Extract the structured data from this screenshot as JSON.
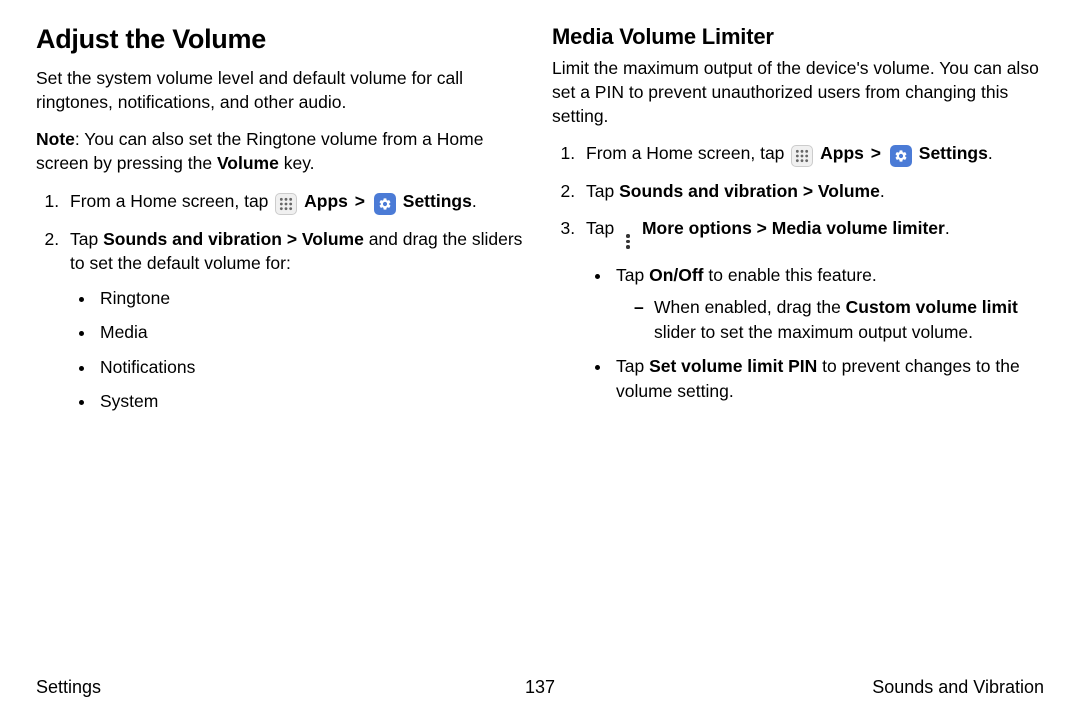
{
  "left": {
    "title": "Adjust the Volume",
    "intro": "Set the system volume level and default volume for call ringtones, notifications, and other audio.",
    "note_label": "Note",
    "note_pre": ": You can also set the Ringtone volume from a Home screen by pressing the ",
    "note_bold": "Volume",
    "note_post": " key.",
    "step1_pre": "From a Home screen, tap ",
    "apps_label": "Apps",
    "chev": ">",
    "settings_label": "Settings",
    "period": ".",
    "step2_pre": "Tap ",
    "step2_bold": "Sounds and vibration > Volume",
    "step2_post": " and drag the sliders to set the default volume for:",
    "bullets": {
      "b0": "Ringtone",
      "b1": "Media",
      "b2": "Notifications",
      "b3": "System"
    }
  },
  "right": {
    "title": "Media Volume Limiter",
    "intro": "Limit the maximum output of the device's volume. You can also set a PIN to prevent unauthorized users from changing this setting.",
    "step1_pre": "From a Home screen, tap ",
    "step2_pre": "Tap ",
    "step2_bold": "Sounds and vibration > Volume",
    "step3_pre": "Tap ",
    "step3_bold": "More options > Media volume limiter",
    "sub1_pre": "Tap ",
    "sub1_bold": "On/Off",
    "sub1_post": " to enable this feature.",
    "dash_pre": "When enabled, drag the ",
    "dash_bold": "Custom volume limit",
    "dash_post": " slider to set the maximum output volume.",
    "sub2_pre": "Tap ",
    "sub2_bold": "Set volume limit PIN",
    "sub2_post": " to prevent changes to the volume setting."
  },
  "footer": {
    "left": "Settings",
    "center": "137",
    "right": "Sounds and Vibration"
  }
}
